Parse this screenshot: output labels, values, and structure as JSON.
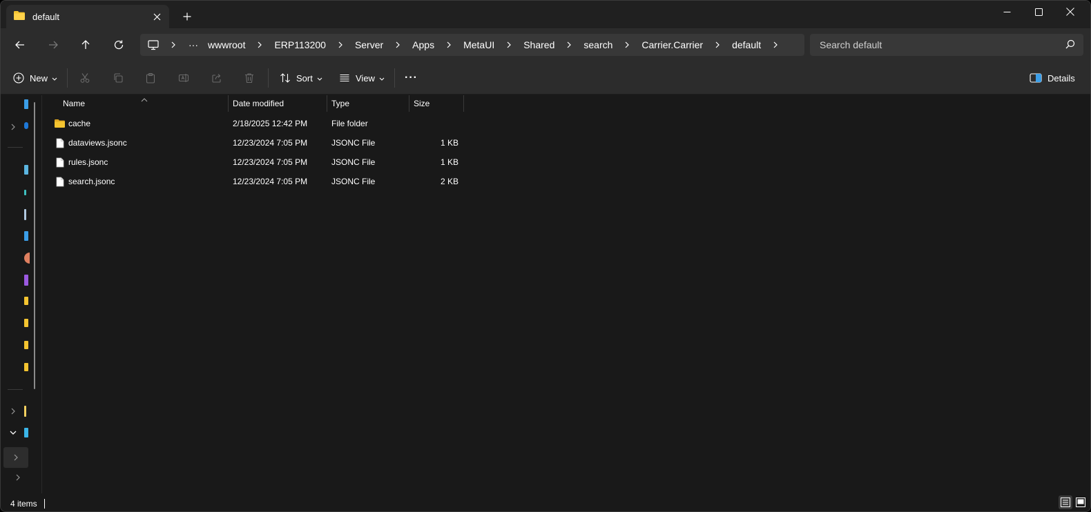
{
  "titlebar": {
    "tab_title": "default",
    "tab_icon": "folder-icon",
    "close_tab_icon": "close-icon",
    "new_tab_icon": "plus-icon",
    "window_controls": [
      "minimize-icon",
      "maximize-icon",
      "close-icon"
    ]
  },
  "navigation": {
    "back_icon": "arrow-left-icon",
    "forward_icon": "arrow-right-icon",
    "up_icon": "arrow-up-icon",
    "refresh_icon": "refresh-icon"
  },
  "address": {
    "root_icon": "computer-icon",
    "overflow_label": "···",
    "crumbs": [
      "wwwroot",
      "ERP113200",
      "Server",
      "Apps",
      "MetaUI",
      "Shared",
      "search",
      "Carrier.Carrier",
      "default"
    ]
  },
  "search": {
    "placeholder": "Search default"
  },
  "commands": {
    "new_label": "New",
    "sort_label": "Sort",
    "view_label": "View",
    "more_label": "···",
    "details_label": "Details",
    "disabled_actions": [
      "cut-icon",
      "copy-icon",
      "paste-icon",
      "rename-icon",
      "share-icon",
      "delete-icon"
    ]
  },
  "columns": {
    "name": "Name",
    "date": "Date modified",
    "type": "Type",
    "size": "Size"
  },
  "files": [
    {
      "name": "cache",
      "date": "2/18/2025 12:42 PM",
      "type": "File folder",
      "size": "",
      "icon": "folder-icon"
    },
    {
      "name": "dataviews.jsonc",
      "date": "12/23/2024 7:05 PM",
      "type": "JSONC File",
      "size": "1 KB",
      "icon": "file-icon"
    },
    {
      "name": "rules.jsonc",
      "date": "12/23/2024 7:05 PM",
      "type": "JSONC File",
      "size": "1 KB",
      "icon": "file-icon"
    },
    {
      "name": "search.jsonc",
      "date": "12/23/2024 7:05 PM",
      "type": "JSONC File",
      "size": "2 KB",
      "icon": "file-icon"
    }
  ],
  "status": {
    "item_count": "4 items"
  },
  "colors": {
    "folder": "#f4c430",
    "accent_blue": "#3b9ee8",
    "window_bg": "#191919",
    "toolbar_bg": "#2c2c2c"
  }
}
